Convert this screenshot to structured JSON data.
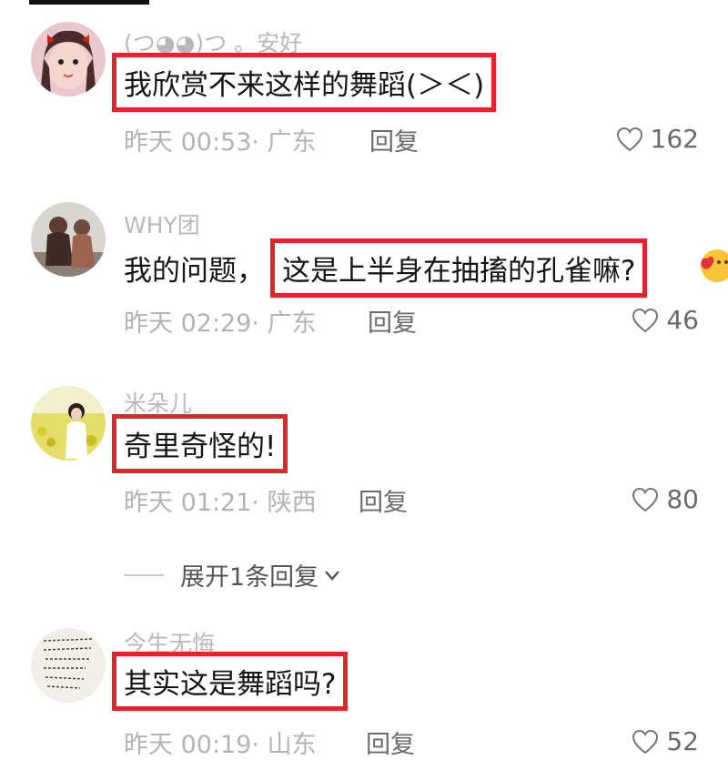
{
  "comments": [
    {
      "username": "(つ◕◕)つ 。安好",
      "text": "我欣赏不来这样的舞蹈(＞＜)",
      "time": "昨天 00:53",
      "location": "· 广东",
      "reply_label": "回复",
      "likes": "162"
    },
    {
      "username": "WHY团",
      "prefix": "我的问题，",
      "text": "这是上半身在抽搐的孔雀嘛?",
      "time": "昨天 02:29",
      "location": "· 广东",
      "reply_label": "回复",
      "likes": "46"
    },
    {
      "username": "米朵儿",
      "text": "奇里奇怪的!",
      "time": "昨天 01:21",
      "location": "· 陕西",
      "reply_label": "回复",
      "likes": "80"
    },
    {
      "username": "今生无悔",
      "text": "其实这是舞蹈吗?",
      "time": "昨天 00:19",
      "location": "· 山东",
      "reply_label": "回复",
      "likes": "52"
    }
  ],
  "expand_replies": "展开1条回复",
  "colors": {
    "highlight": "#e0262c",
    "meta": "#b3b3b3"
  },
  "icons": [
    "heart-outline-icon",
    "chevron-down-icon",
    "emoji-icon"
  ]
}
